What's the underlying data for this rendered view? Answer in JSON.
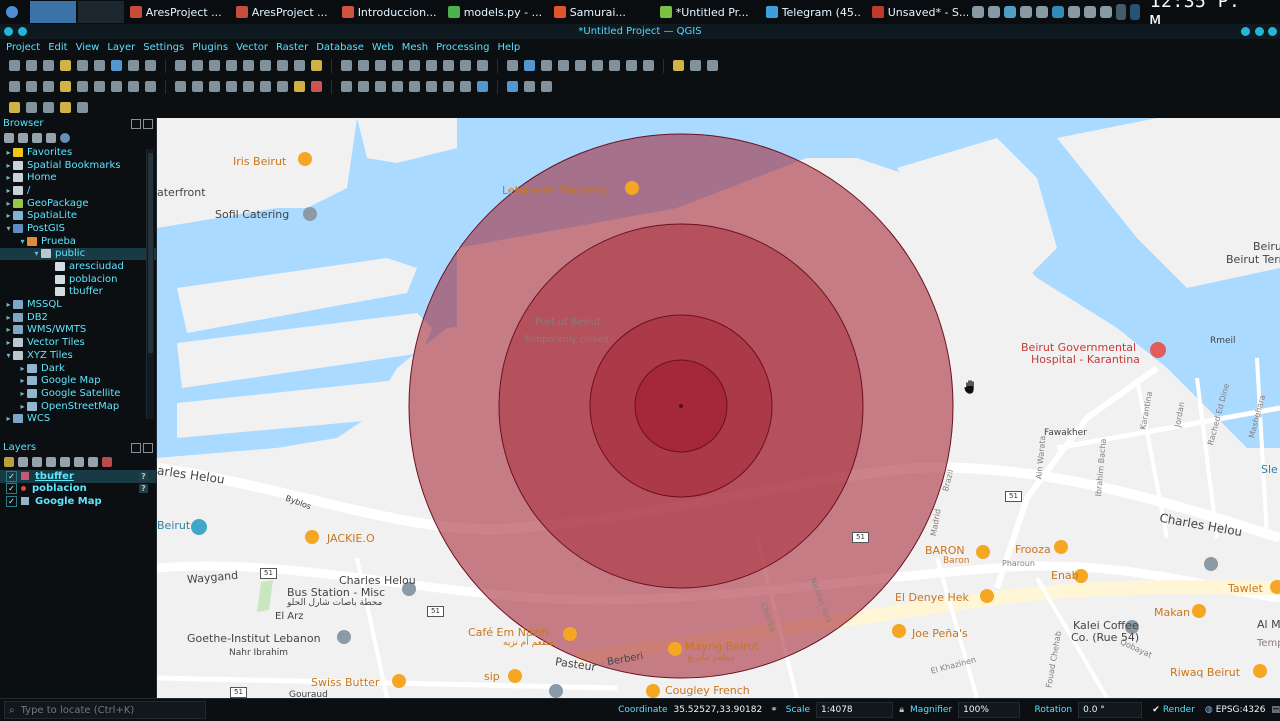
{
  "taskbar": {
    "apps": [
      {
        "label": "AresProject ...",
        "color": "#c94b3b"
      },
      {
        "label": "AresProject ...",
        "color": "#c94b3b"
      },
      {
        "label": "Introduccion...",
        "color": "#d0533d"
      },
      {
        "label": "models.py - ...",
        "color": "#4caf50"
      },
      {
        "label": "Samurai...",
        "color": "#e0542e"
      },
      {
        "label": "*Untitled Pr...",
        "color": "#7ac143"
      },
      {
        "label": "Telegram (45...",
        "color": "#3aa0db"
      },
      {
        "label": "Unsaved* - S...",
        "color": "#c0392b"
      }
    ],
    "clock": "12:35 P. M."
  },
  "window": {
    "title": "*Untitled Project — QGIS"
  },
  "menubar": {
    "items": [
      "Project",
      "Edit",
      "View",
      "Layer",
      "Settings",
      "Plugins",
      "Vector",
      "Raster",
      "Database",
      "Web",
      "Mesh",
      "Processing",
      "Help"
    ]
  },
  "browser": {
    "title": "Browser",
    "items": [
      {
        "label": "Favorites",
        "depth": 0,
        "icon": "star-icon",
        "color": "#f0c419"
      },
      {
        "label": "Spatial Bookmarks",
        "depth": 0,
        "icon": "bookmark-icon",
        "color": "#c7d3da"
      },
      {
        "label": "Home",
        "depth": 0,
        "icon": "home-folder-icon",
        "color": "#c7d3da"
      },
      {
        "label": "/",
        "depth": 0,
        "icon": "folder-icon",
        "color": "#c7d3da"
      },
      {
        "label": "GeoPackage",
        "depth": 0,
        "icon": "geopackage-icon",
        "color": "#9ac34a"
      },
      {
        "label": "SpatiaLite",
        "depth": 0,
        "icon": "feather-icon",
        "color": "#7fb4d9"
      },
      {
        "label": "PostGIS",
        "depth": 0,
        "icon": "elephant-icon",
        "color": "#5b8ec1"
      },
      {
        "label": "Prueba",
        "depth": 1,
        "icon": "connection-icon",
        "color": "#e08a3c"
      },
      {
        "label": "public",
        "depth": 2,
        "icon": "schema-icon",
        "color": "#b9c7cf",
        "selected": true
      },
      {
        "label": "aresciudad",
        "depth": 3,
        "icon": "polygon-layer-icon",
        "color": "#d2dde3"
      },
      {
        "label": "poblacion",
        "depth": 3,
        "icon": "point-layer-icon",
        "color": "#d2dde3"
      },
      {
        "label": "tbuffer",
        "depth": 3,
        "icon": "polygon-layer-icon",
        "color": "#d2dde3"
      },
      {
        "label": "MSSQL",
        "depth": 0,
        "icon": "mssql-icon",
        "color": "#7fa6c8"
      },
      {
        "label": "DB2",
        "depth": 0,
        "icon": "db2-icon",
        "color": "#7fa6c8"
      },
      {
        "label": "WMS/WMTS",
        "depth": 0,
        "icon": "globe-icon",
        "color": "#7fa6c8"
      },
      {
        "label": "Vector Tiles",
        "depth": 0,
        "icon": "grid-icon",
        "color": "#b9c7cf"
      },
      {
        "label": "XYZ Tiles",
        "depth": 0,
        "icon": "grid-icon",
        "color": "#b9c7cf"
      },
      {
        "label": "Dark",
        "depth": 1,
        "icon": "grid-icon",
        "color": "#8fb6cc"
      },
      {
        "label": "Google Map",
        "depth": 1,
        "icon": "grid-icon",
        "color": "#8fb6cc"
      },
      {
        "label": "Google Satellite",
        "depth": 1,
        "icon": "grid-icon",
        "color": "#8fb6cc"
      },
      {
        "label": "OpenStreetMap",
        "depth": 1,
        "icon": "grid-icon",
        "color": "#8fb6cc"
      },
      {
        "label": "WCS",
        "depth": 0,
        "icon": "globe-icon",
        "color": "#7fa6c8"
      }
    ]
  },
  "layers": {
    "title": "Layers",
    "items": [
      {
        "label": "tbuffer",
        "checked": true,
        "icon": "polygon-style-icon",
        "color": "#c35a72",
        "selected": true
      },
      {
        "label": "poblacion",
        "checked": true,
        "icon": "point-style-icon",
        "color": "#e0454a"
      },
      {
        "label": "Google Map",
        "checked": true,
        "icon": "xyz-tile-icon",
        "color": "#8fb6cc"
      }
    ]
  },
  "map": {
    "labels": {
      "iris": "Iris Beirut",
      "waterfront": "aterfront",
      "sofil": "Sofil Catering",
      "embassy": "Lebanese Embassy",
      "port": "Port of Beirut",
      "port_sub": "Temporarily closed",
      "terminal": "Beirut\nTerminal C",
      "hospital1": "Beirut Governmental",
      "hospital2": "Hospital - Karantina",
      "rmeil": "Rmeil",
      "fawakher": "Fawakher",
      "charles_helou_w": "arles Helou",
      "charles_helou_e": "Charles Helou",
      "jackie": "JACKIE.O",
      "beirut_w": "Beirut",
      "wayghand": "Waygand",
      "bus1": "Charles Helou",
      "bus2": "Bus Station - Misc",
      "bus3": "محطة باصات شارل الحلو",
      "el_arz": "El Arz",
      "goethe": "Goethe-Institut Lebanon",
      "nahr": "Nahr Ibrahim",
      "cafe": "Café Em Nazih",
      "cafe_ar": "مطعم أم نزيه",
      "mayrig": "Mayrig Beirut",
      "mayrig_ar": "مطعم مايريغ",
      "swiss": "Swiss Butter",
      "sip": "sip",
      "pasteur": "Pasteur",
      "berberi": "Berberi",
      "gouraud": "Gouraud",
      "cougley": "Cougley French",
      "baron": "BARON",
      "baron_ar": "Baron",
      "frooza": "Frooza",
      "enab": "Enab",
      "el_denye": "El Denye Hek",
      "joe": "Joe Peña's",
      "kalei1": "Kalei Coffee",
      "kalei2": "Co. (Rue 54)",
      "makan": "Makan",
      "tawlet": "Tawlet",
      "riwaq": "Riwaq Beirut",
      "alm": "Al M",
      "temp": "Temp",
      "sle": "Sle",
      "byblos": "Byblos",
      "madrid": "Madrid",
      "brazil": "Brazil",
      "ibrahim": "Ibrahim Bacha",
      "ain": "Ain Warata",
      "nicolas": "Nicolas Turk",
      "charika": "Charika",
      "pharoun": "Pharoun",
      "khazinen": "El Khazinen",
      "qobayat": "Qobayat",
      "karantina": "Karantina",
      "jordan": "Jordan",
      "rached": "Rached Ed Dine",
      "mashghara": "Mashghara",
      "fuad": "Fouad Chehab",
      "r51a": "51",
      "r51b": "51",
      "r51c": "51",
      "r51d": "51",
      "r51e": "51"
    }
  },
  "statusbar": {
    "locator_placeholder": "Type to locate (Ctrl+K)",
    "coordinate_label": "Coordinate",
    "coordinate_value": "35.52527,33.90182",
    "scale_label": "Scale",
    "scale_value": "1:4078",
    "magnifier_label": "Magnifier",
    "magnifier_value": "100%",
    "rotation_label": "Rotation",
    "rotation_value": "0.0 °",
    "render_label": "Render",
    "crs_label": "EPSG:4326"
  },
  "colors": {
    "accent": "#59e1ff",
    "buffer_fill": "#a01c2c",
    "water": "#aadaff"
  }
}
